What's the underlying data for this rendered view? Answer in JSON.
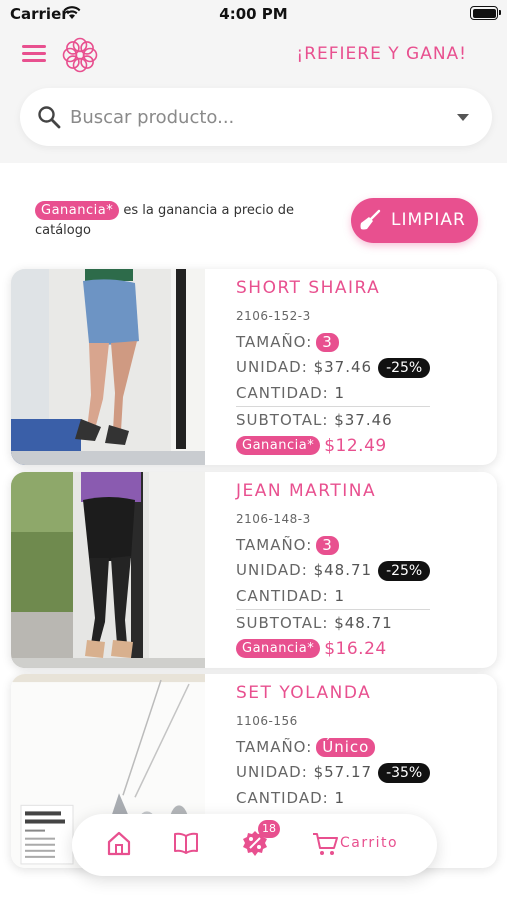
{
  "status_bar": {
    "carrier": "Carrier",
    "time": "4:00 PM"
  },
  "header": {
    "refer_link": "¡REFIERE Y GANA!"
  },
  "search": {
    "placeholder": "Buscar producto..."
  },
  "legend": {
    "badge": "Ganancia*",
    "text": " es la ganancia a precio de catálogo"
  },
  "clear_button": {
    "label": "LIMPIAR"
  },
  "labels": {
    "size": "TAMAÑO:",
    "unit": "UNIDAD:",
    "quantity": "CANTIDAD:",
    "subtotal": "SUBTOTAL:",
    "gain_badge": "Ganancia*"
  },
  "products": [
    {
      "name": "SHORT SHAIRA",
      "sku": "2106-152-3",
      "size": "3",
      "unit_price": "$37.46",
      "discount": "-25%",
      "quantity": "1",
      "subtotal": "$37.46",
      "gain": "$12.49"
    },
    {
      "name": "JEAN MARTINA",
      "sku": "2106-148-3",
      "size": "3",
      "unit_price": "$48.71",
      "discount": "-25%",
      "quantity": "1",
      "subtotal": "$48.71",
      "gain": "$16.24"
    },
    {
      "name": "SET YOLANDA",
      "sku": "1106-156",
      "size": "Único",
      "unit_price": "$57.17",
      "discount": "-35%",
      "quantity": "1"
    }
  ],
  "bottom_nav": {
    "promo_count": "18",
    "cart_label": "Carrito",
    "icons": [
      "home-icon",
      "book-icon",
      "promo-icon",
      "cart-icon"
    ]
  },
  "colors": {
    "accent": "#e8508f",
    "discount_badge": "#111111",
    "header_bg": "#f5f5f5"
  }
}
